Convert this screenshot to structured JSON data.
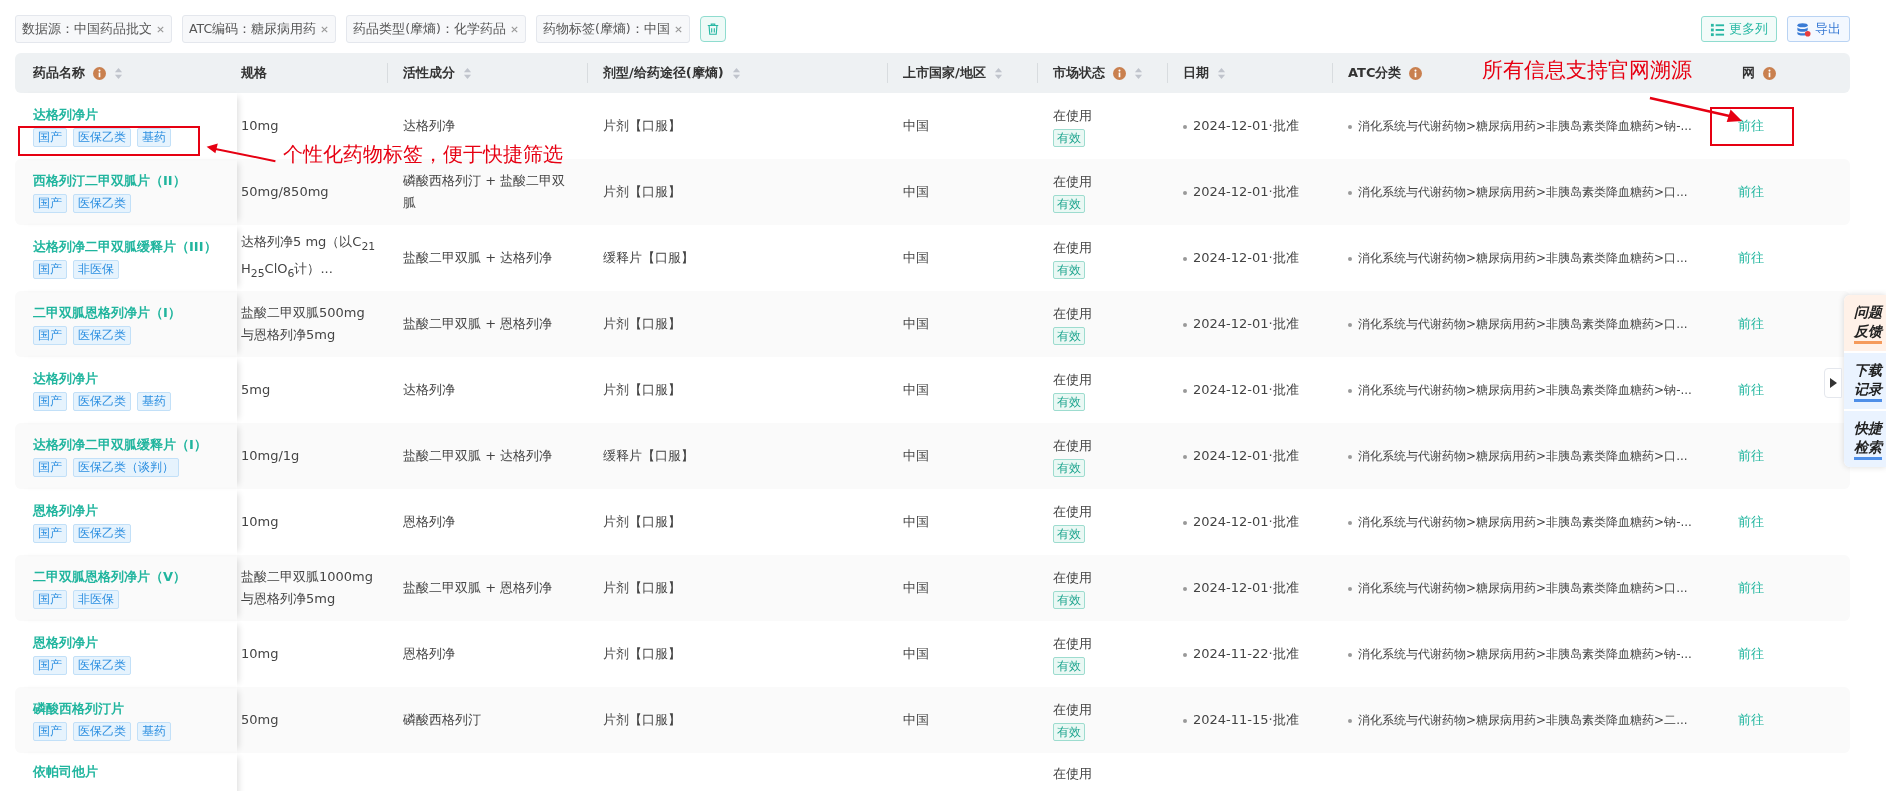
{
  "filters": [
    {
      "label": "数据源：中国药品批文"
    },
    {
      "label": "ATC编码：糖尿病用药"
    },
    {
      "label": "药品类型(摩熵)：化学药品"
    },
    {
      "label": "药物标签(摩熵)：中国"
    }
  ],
  "toolbar": {
    "buttons": [
      {
        "label": "更多列",
        "kind": "columns"
      },
      {
        "label": "导出",
        "kind": "export"
      }
    ]
  },
  "table": {
    "columns": [
      {
        "label": "药品名称",
        "info": true,
        "sortable": true
      },
      {
        "label": "规格",
        "info": false,
        "sortable": false
      },
      {
        "label": "活性成分",
        "info": false,
        "sortable": true
      },
      {
        "label": "剂型/给药途径(摩熵)",
        "info": false,
        "sortable": true
      },
      {
        "label": "上市国家/地区",
        "info": false,
        "sortable": true
      },
      {
        "label": "市场状态",
        "info": true,
        "sortable": true
      },
      {
        "label": "日期",
        "info": false,
        "sortable": true
      },
      {
        "label": "ATC分类",
        "info": true,
        "sortable": false
      },
      {
        "label": "网",
        "info": true,
        "sortable": false
      }
    ],
    "rows": [
      {
        "name": "达格列净片",
        "tags": [
          "国产",
          "医保乙类",
          "基药"
        ],
        "spec": "10mg",
        "ingredient": "达格列净",
        "form": "片剂【口服】",
        "country": "中国",
        "status": "在使用",
        "status_tag": "有效",
        "date": "2024-12-01·批准",
        "atc": "消化系统与代谢药物>糖尿病用药>非胰岛素类降血糖药>钠-...",
        "link": "前往"
      },
      {
        "name": "西格列汀二甲双胍片（II）",
        "tags": [
          "国产",
          "医保乙类"
        ],
        "spec": "50mg/850mg",
        "ingredient": "磷酸西格列汀 + 盐酸二甲双胍",
        "form": "片剂【口服】",
        "country": "中国",
        "status": "在使用",
        "status_tag": "有效",
        "date": "2024-12-01·批准",
        "atc": "消化系统与代谢药物>糖尿病用药>非胰岛素类降血糖药>口...",
        "link": "前往"
      },
      {
        "name": "达格列净二甲双胍缓释片（III）",
        "tags": [
          "国产",
          "非医保"
        ],
        "spec": "达格列净5 mg（以C$_{21}$H$_{25}$ClO$_{6}$计）...",
        "ingredient": "盐酸二甲双胍 + 达格列净",
        "form": "缓释片【口服】",
        "country": "中国",
        "status": "在使用",
        "status_tag": "有效",
        "date": "2024-12-01·批准",
        "atc": "消化系统与代谢药物>糖尿病用药>非胰岛素类降血糖药>口...",
        "link": "前往"
      },
      {
        "name": "二甲双胍恩格列净片（Ⅰ）",
        "tags": [
          "国产",
          "医保乙类"
        ],
        "spec": "盐酸二甲双胍500mg与恩格列净5mg",
        "ingredient": "盐酸二甲双胍 + 恩格列净",
        "form": "片剂【口服】",
        "country": "中国",
        "status": "在使用",
        "status_tag": "有效",
        "date": "2024-12-01·批准",
        "atc": "消化系统与代谢药物>糖尿病用药>非胰岛素类降血糖药>口...",
        "link": "前往"
      },
      {
        "name": "达格列净片",
        "tags": [
          "国产",
          "医保乙类",
          "基药"
        ],
        "spec": "5mg",
        "ingredient": "达格列净",
        "form": "片剂【口服】",
        "country": "中国",
        "status": "在使用",
        "status_tag": "有效",
        "date": "2024-12-01·批准",
        "atc": "消化系统与代谢药物>糖尿病用药>非胰岛素类降血糖药>钠-...",
        "link": "前往"
      },
      {
        "name": "达格列净二甲双胍缓释片（I）",
        "tags": [
          "国产",
          "医保乙类（谈判）"
        ],
        "spec": "10mg/1g",
        "ingredient": "盐酸二甲双胍 + 达格列净",
        "form": "缓释片【口服】",
        "country": "中国",
        "status": "在使用",
        "status_tag": "有效",
        "date": "2024-12-01·批准",
        "atc": "消化系统与代谢药物>糖尿病用药>非胰岛素类降血糖药>口...",
        "link": "前往"
      },
      {
        "name": "恩格列净片",
        "tags": [
          "国产",
          "医保乙类"
        ],
        "spec": "10mg",
        "ingredient": "恩格列净",
        "form": "片剂【口服】",
        "country": "中国",
        "status": "在使用",
        "status_tag": "有效",
        "date": "2024-12-01·批准",
        "atc": "消化系统与代谢药物>糖尿病用药>非胰岛素类降血糖药>钠-...",
        "link": "前往"
      },
      {
        "name": "二甲双胍恩格列净片（V）",
        "tags": [
          "国产",
          "非医保"
        ],
        "spec": "盐酸二甲双胍1000mg与恩格列净5mg",
        "ingredient": "盐酸二甲双胍 + 恩格列净",
        "form": "片剂【口服】",
        "country": "中国",
        "status": "在使用",
        "status_tag": "有效",
        "date": "2024-12-01·批准",
        "atc": "消化系统与代谢药物>糖尿病用药>非胰岛素类降血糖药>口...",
        "link": "前往"
      },
      {
        "name": "恩格列净片",
        "tags": [
          "国产",
          "医保乙类"
        ],
        "spec": "10mg",
        "ingredient": "恩格列净",
        "form": "片剂【口服】",
        "country": "中国",
        "status": "在使用",
        "status_tag": "有效",
        "date": "2024-11-22·批准",
        "atc": "消化系统与代谢药物>糖尿病用药>非胰岛素类降血糖药>钠-...",
        "link": "前往"
      },
      {
        "name": "磷酸西格列汀片",
        "tags": [
          "国产",
          "医保乙类",
          "基药"
        ],
        "spec": "50mg",
        "ingredient": "磷酸西格列汀",
        "form": "片剂【口服】",
        "country": "中国",
        "status": "在使用",
        "status_tag": "有效",
        "date": "2024-11-15·批准",
        "atc": "消化系统与代谢药物>糖尿病用药>非胰岛素类降血糖药>二...",
        "link": "前往"
      },
      {
        "name": "依帕司他片",
        "status": "在使用"
      }
    ]
  },
  "side_panel": {
    "items": [
      {
        "label": "问题反馈",
        "kind": "feedback"
      },
      {
        "label": "下载记录",
        "kind": "download"
      },
      {
        "label": "快捷检索",
        "kind": "search"
      }
    ]
  },
  "annotations": {
    "tags_note": "个性化药物标签，便于快捷筛选",
    "link_note": "所有信息支持官网溯源"
  }
}
